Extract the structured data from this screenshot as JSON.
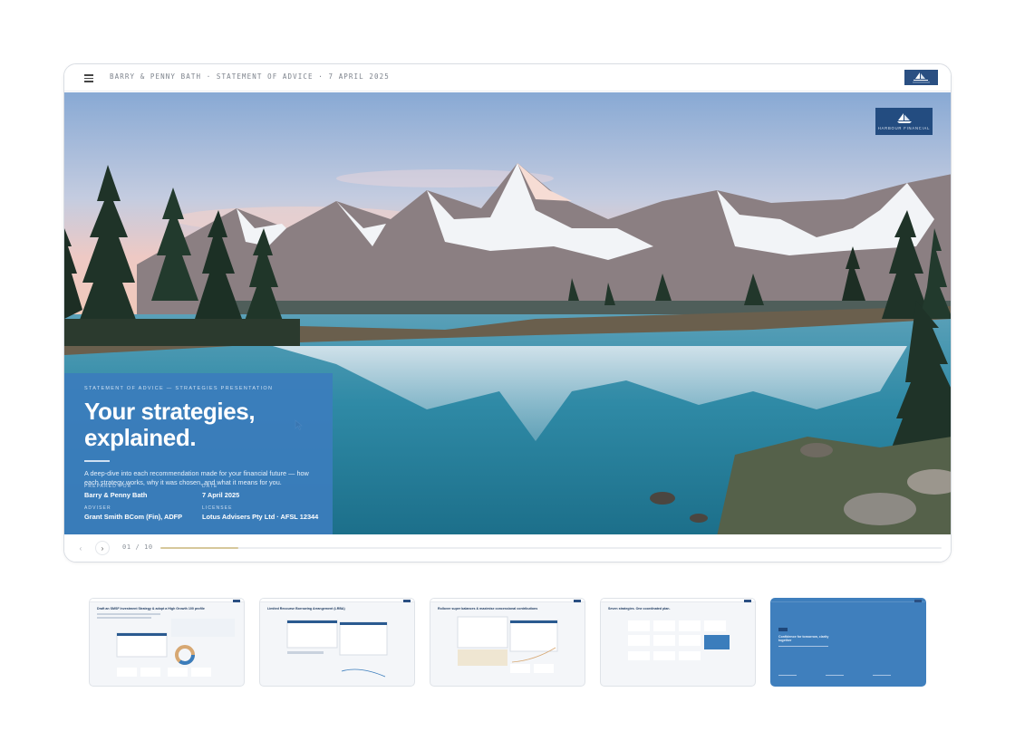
{
  "header": {
    "breadcrumb": "BARRY & PENNY BATH · STATEMENT OF ADVICE · 7 APRIL 2025"
  },
  "brand": {
    "name": "HARBOUR FINANCIAL",
    "color": "#234c80"
  },
  "hero_card": {
    "eyebrow": "STATEMENT OF ADVICE — STRATEGIES PRESENTATION",
    "title_line1": "Your strategies,",
    "title_line2": "explained.",
    "description": "A deep-dive into each recommendation made for your financial future — how each strategy works, why it was chosen, and what it means for you.",
    "prepared_for_label": "PREPARED FOR",
    "prepared_for": "Barry & Penny Bath",
    "date_label": "DATE",
    "date": "7 April 2025",
    "adviser_label": "ADVISER",
    "adviser": "Grant Smith BCom (Fin), ADFP",
    "licensee_label": "LICENSEE",
    "licensee": "Lotus Advisers Pty Ltd · AFSL 12344",
    "accent_color": "#3b7dbc"
  },
  "controls": {
    "prev_icon": "‹",
    "next_icon": "›",
    "counter": "01 / 10",
    "progress": 0.1
  },
  "thumbnails": [
    {
      "title": "Draft an SMSF Investment Strategy & adopt a High Growth 100 profile"
    },
    {
      "title": "Limited Recourse Borrowing Arrangement (LRBA)"
    },
    {
      "title": "Rollover super balances & maximise concessional contributions"
    },
    {
      "title": "Seven strategies. One coordinated plan."
    },
    {
      "title": "Confidence for tomorrow, clarity together"
    }
  ]
}
